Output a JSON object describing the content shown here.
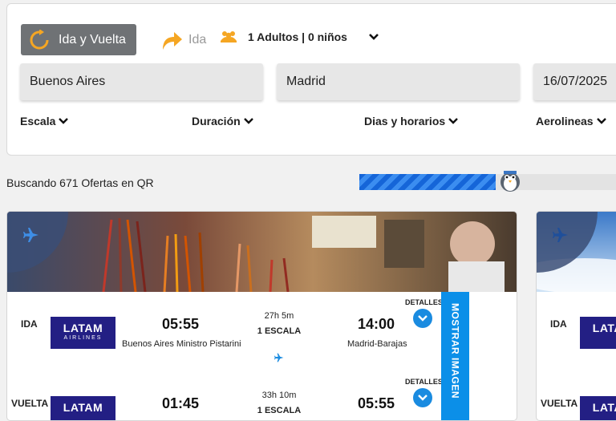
{
  "search": {
    "trip_type_label": "Ida y Vuelta",
    "oneway_label": "Ida",
    "passengers_label": "1 Adultos | 0 niños",
    "origin": "Buenos Aires",
    "destination": "Madrid",
    "date": "16/07/2025"
  },
  "filters": {
    "stops": "Escala",
    "duration": "Duración",
    "days": "Dias y horarios",
    "airlines": "Aerolineas"
  },
  "status": {
    "text": "Buscando 671 Ofertas en QR",
    "progress": 0.53
  },
  "results": [
    {
      "outbound": {
        "label": "IDA",
        "airline_l1": "LATAM",
        "airline_l2": "AIRLINES",
        "dep_time": "05:55",
        "dep_airport": "Buenos Aires Ministro Pistarini",
        "duration": "27h 5m",
        "stops": "1 ESCALA",
        "arr_time": "14:00",
        "arr_airport": "Madrid-Barajas",
        "details": "DETALLES"
      },
      "inbound": {
        "label": "VUELTA",
        "airline_l1": "LATAM",
        "dep_time": "01:45",
        "duration": "33h 10m",
        "stops": "1 ESCALA",
        "arr_time": "05:55",
        "details": "DETALLES"
      },
      "show_image": "MOSTRAR IMAGEN"
    },
    {
      "outbound": {
        "label": "IDA",
        "airline_l1": "LATAM"
      },
      "inbound": {
        "label": "VUELTA",
        "airline_l1": "LATAM"
      }
    }
  ],
  "colors": {
    "accent_blue": "#1a8be0",
    "latam_navy": "#231f84",
    "orange": "#f5a623"
  }
}
